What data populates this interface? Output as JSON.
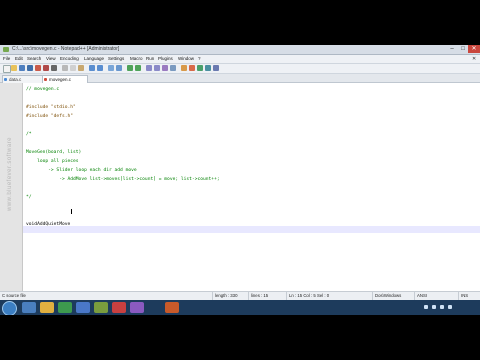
{
  "window": {
    "title": "C:\\...\\src\\movegen.c - Notepad++ [Administrator]"
  },
  "menu": {
    "items": [
      "File",
      "Edit",
      "Search",
      "View",
      "Encoding",
      "Language",
      "Settings",
      "Macro",
      "Run",
      "Plugins",
      "Window",
      "?"
    ]
  },
  "tabs": [
    {
      "label": "data.c"
    },
    {
      "label": "movegen.c"
    }
  ],
  "watermark": "www.bluefever.software",
  "code": {
    "lines": [
      {
        "text": "// movegen.c",
        "kind": "comment"
      },
      {
        "text": "",
        "kind": "plain"
      },
      {
        "text": "#include \"stdio.h\"",
        "kind": "pre"
      },
      {
        "text": "#include \"defs.h\"",
        "kind": "pre"
      },
      {
        "text": "",
        "kind": "plain"
      },
      {
        "text": "/*",
        "kind": "comment"
      },
      {
        "text": "",
        "kind": "plain"
      },
      {
        "text": "MoveGen(board, list)",
        "kind": "comment"
      },
      {
        "text": "    loop all pieces",
        "kind": "comment"
      },
      {
        "text": "        -> Slider loop each dir add move",
        "kind": "comment"
      },
      {
        "text": "            -> AddMove list->moves[list->count] = move; list->count++;",
        "kind": "comment"
      },
      {
        "text": "",
        "kind": "comment"
      },
      {
        "text": "*/",
        "kind": "comment"
      },
      {
        "text": "",
        "kind": "plain"
      },
      {
        "text": "",
        "kind": "plain"
      },
      {
        "text": "voidAddQuietMove",
        "kind": "plain"
      }
    ]
  },
  "status": {
    "filetype": "C source file",
    "length": "length : 330",
    "lines": "lines : 15",
    "position": "Ln : 15    Col : 5    Sel : 0",
    "eol": "Dos\\Windows",
    "encoding": "ANSI",
    "mode": "INS"
  },
  "colors": {
    "comment": "#008000",
    "preprocessor": "#7a4b00",
    "current_line": "#e8e8ff",
    "taskbar": "#1d3b5c"
  }
}
